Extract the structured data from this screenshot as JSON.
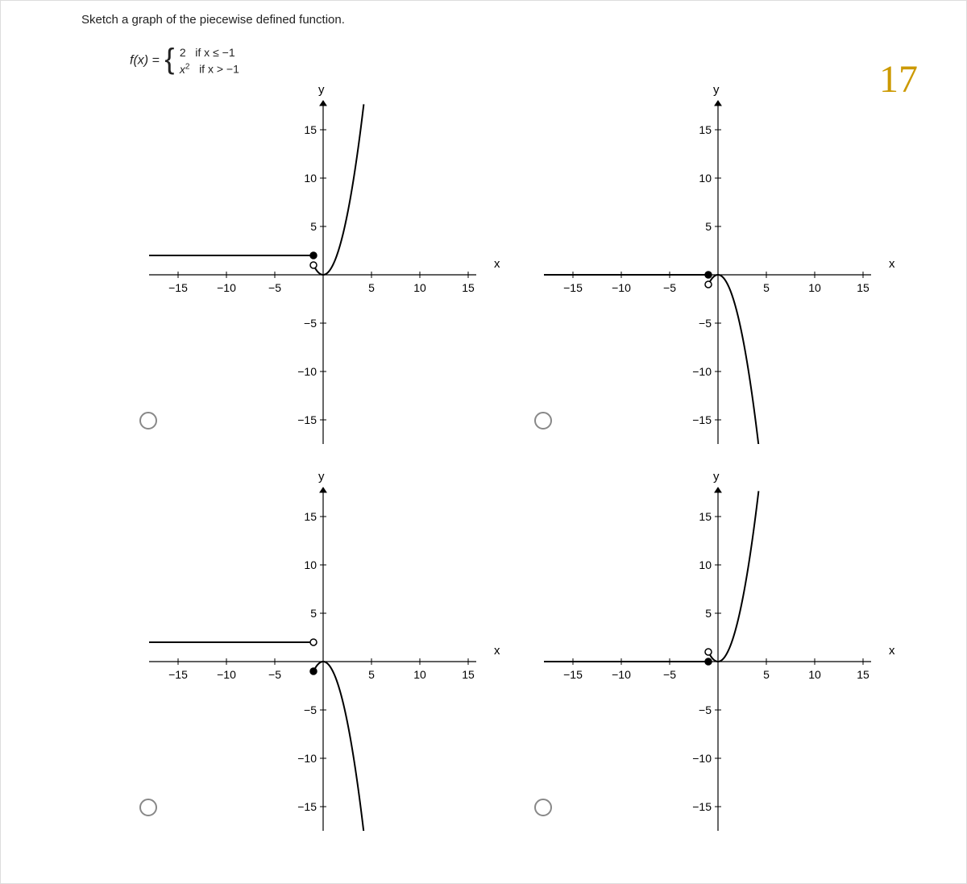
{
  "question": "Sketch a graph of the piecewise defined function.",
  "func_lhs": "f(x) =",
  "piece1_val": "2",
  "piece1_cond": "if x ≤ −1",
  "piece2_val": "x",
  "piece2_exp": "2",
  "piece2_cond": "if x > −1",
  "annotation": "17",
  "axes": {
    "x_ticks": [
      "−15",
      "−10",
      "−5",
      "5",
      "10",
      "15"
    ],
    "y_ticks": [
      "15",
      "10",
      "5",
      "−5",
      "−10",
      "−15"
    ],
    "xlabel": "x",
    "ylabel": "y"
  },
  "chart_data": [
    {
      "type": "line",
      "xlim": [
        -18,
        18
      ],
      "ylim": [
        -18,
        18
      ],
      "xlabel": "x",
      "ylabel": "y",
      "series": [
        {
          "name": "flat-left",
          "piece": "constant",
          "y": 2,
          "x_from": -18,
          "x_to": -1,
          "endpoint": {
            "x": -1,
            "y": 2,
            "open": false
          }
        },
        {
          "name": "parabola-right",
          "piece": "x^2",
          "x_from": -1,
          "x_to": 4.3,
          "endpoint": {
            "x": -1,
            "y": 1,
            "open": true
          }
        }
      ]
    },
    {
      "type": "line",
      "xlim": [
        -18,
        18
      ],
      "ylim": [
        -18,
        18
      ],
      "xlabel": "x",
      "ylabel": "y",
      "series": [
        {
          "name": "flat-left",
          "piece": "constant",
          "y": 0,
          "x_from": -18,
          "x_to": -1,
          "endpoint": {
            "x": -1,
            "y": 0,
            "open": false
          }
        },
        {
          "name": "neg-parabola-right",
          "piece": "-x^2",
          "x_from": -1,
          "x_to": 4.3,
          "endpoint": {
            "x": -1,
            "y": -1,
            "open": true
          }
        }
      ]
    },
    {
      "type": "line",
      "xlim": [
        -18,
        18
      ],
      "ylim": [
        -18,
        18
      ],
      "xlabel": "x",
      "ylabel": "y",
      "series": [
        {
          "name": "flat-left",
          "piece": "constant",
          "y": 2,
          "x_from": -18,
          "x_to": -1,
          "endpoint": {
            "x": -1,
            "y": 2,
            "open": true
          }
        },
        {
          "name": "neg-parabola-right",
          "piece": "-x^2",
          "x_from": -1,
          "x_to": 4.3,
          "endpoint": {
            "x": -1,
            "y": -1,
            "open": false
          }
        }
      ]
    },
    {
      "type": "line",
      "xlim": [
        -18,
        18
      ],
      "ylim": [
        -18,
        18
      ],
      "xlabel": "x",
      "ylabel": "y",
      "series": [
        {
          "name": "flat-left",
          "piece": "constant",
          "y": 0,
          "x_from": -18,
          "x_to": -1,
          "endpoint": {
            "x": -1,
            "y": 0,
            "open": false
          }
        },
        {
          "name": "parabola-right",
          "piece": "x^2",
          "x_from": -1,
          "x_to": 4.3,
          "endpoint": {
            "x": -1,
            "y": 1,
            "open": true
          }
        }
      ]
    }
  ]
}
